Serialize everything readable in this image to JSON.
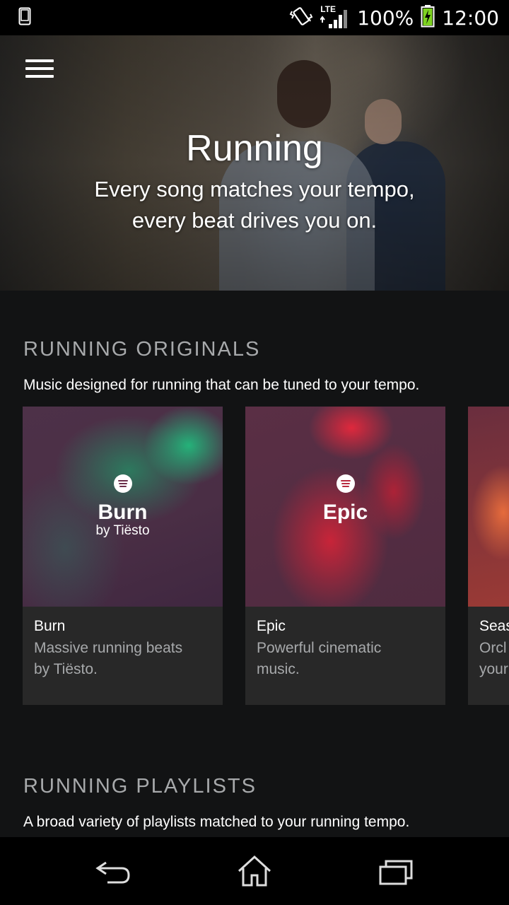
{
  "status": {
    "battery": "100%",
    "time": "12:00",
    "network": "LTE"
  },
  "hero": {
    "title": "Running",
    "subtitle_line1": "Every song matches your tempo,",
    "subtitle_line2": "every beat drives you on."
  },
  "originals": {
    "heading": "RUNNING ORIGINALS",
    "description": "Music designed for running that can be tuned to your tempo.",
    "cards": [
      {
        "cover_title": "Burn",
        "cover_subtitle": "by Tiësto",
        "title": "Burn",
        "desc_line1": "Massive running beats",
        "desc_line2": "by Tiësto."
      },
      {
        "cover_title": "Epic",
        "cover_subtitle": "",
        "title": "Epic",
        "desc_line1": "Powerful cinematic",
        "desc_line2": "music."
      },
      {
        "title": "Seas",
        "desc_line1": "Orcl",
        "desc_line2": "your"
      }
    ]
  },
  "playlists": {
    "heading": "RUNNING PLAYLISTS",
    "description": "A broad variety of playlists matched to your running tempo."
  },
  "colors": {
    "background": "#121314",
    "card": "#282828",
    "muted_text": "#a7a9ab",
    "burn_accent": "#1fb57a",
    "epic_accent": "#e5233a"
  },
  "icons": [
    "menu-icon",
    "phone-icon",
    "vibrate-icon",
    "lte-signal-icon",
    "battery-charging-icon",
    "spotify-icon",
    "back-icon",
    "home-icon",
    "recent-apps-icon"
  ]
}
